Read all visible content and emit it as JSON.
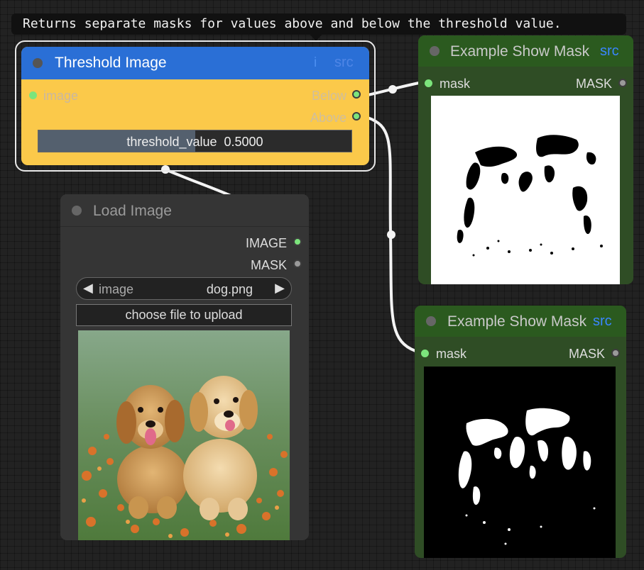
{
  "tooltip": {
    "text": "Returns separate masks for values above and below the threshold value."
  },
  "threshold_node": {
    "title": "Threshold Image",
    "info_icon": "i",
    "src_label": "src",
    "inputs": [
      {
        "label": "image"
      }
    ],
    "outputs": [
      {
        "label": "Below"
      },
      {
        "label": "Above"
      }
    ],
    "widget": {
      "name": "threshold_value",
      "value": "0.5000",
      "fill_fraction": 0.5
    },
    "colors": {
      "title_bar": "#2a6fd6",
      "body": "#fbc94a"
    }
  },
  "load_node": {
    "title": "Load Image",
    "outputs": [
      {
        "label": "IMAGE"
      },
      {
        "label": "MASK"
      }
    ],
    "combo": {
      "name": "image",
      "value": "dog.png",
      "left_arrow": "◀",
      "right_arrow": "▶"
    },
    "upload_label": "choose file to upload",
    "preview_alt": "Two golden retriever puppies sitting in a field of orange flowers"
  },
  "mask_nodes": [
    {
      "title": "Example Show Mask",
      "src_label": "src",
      "input_label": "mask",
      "output_label": "MASK",
      "preview": "white-background-mask"
    },
    {
      "title": "Example Show Mask",
      "src_label": "src",
      "input_label": "mask",
      "output_label": "MASK",
      "preview": "black-background-mask"
    }
  ],
  "colors": {
    "canvas": "#222222",
    "link": "#f2f2f2",
    "mask_title": "#2b5a1f",
    "mask_body": "#2f4d25"
  }
}
